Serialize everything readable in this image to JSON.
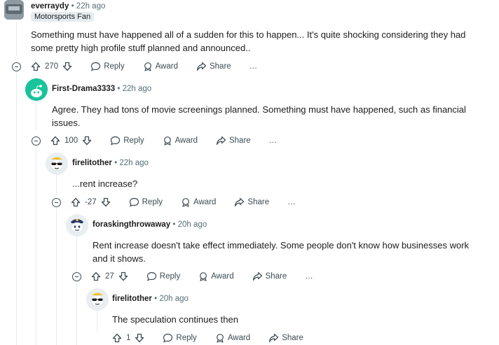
{
  "comments": [
    {
      "username": "everraydy",
      "time": "22h ago",
      "flair": "Motorsports Fan",
      "body": [
        "Something must have happened all of a sudden for this to happen... It's quite shocking considering they had",
        "some pretty high profile stuff planned and announced.."
      ],
      "votes": "270"
    },
    {
      "username": "First-Drama3333",
      "time": "22h ago",
      "body": [
        "Agree. They had tons of movie screenings planned. Something must have happened, such as financial",
        "issues."
      ],
      "votes": "100"
    },
    {
      "username": "firelitother",
      "time": "22h ago",
      "body": [
        "...rent increase?"
      ],
      "votes": "-27"
    },
    {
      "username": "foraskingthrowaway",
      "time": "20h ago",
      "body": [
        "Rent increase doesn't take effect immediately. Some people don't know how businesses work",
        "and it shows."
      ],
      "votes": "27"
    },
    {
      "username": "firelitother",
      "time": "20h ago",
      "body": [
        "The speculation continues then"
      ],
      "votes": "1"
    }
  ],
  "actions": {
    "reply": "Reply",
    "award": "Award",
    "share": "Share",
    "more": "…",
    "separator": "•"
  }
}
